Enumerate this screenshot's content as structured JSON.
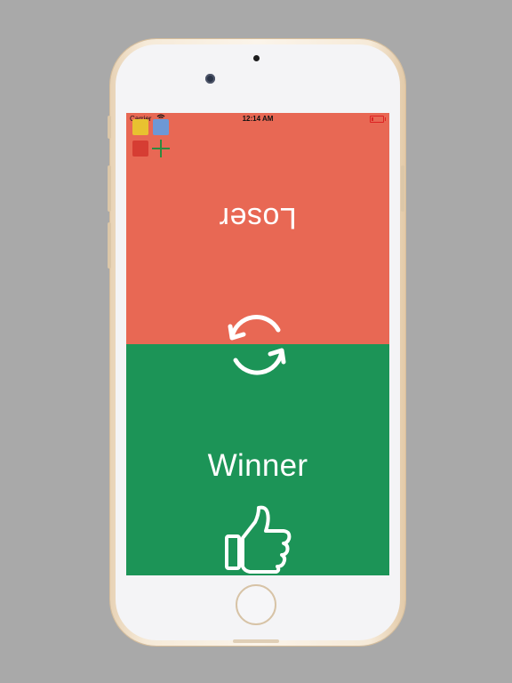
{
  "status_bar": {
    "carrier": "Carrier",
    "time": "12:14 AM",
    "battery_level": 0.15
  },
  "palette": {
    "swatches": [
      {
        "name": "yellow",
        "color": "#e8c230"
      },
      {
        "name": "blue",
        "color": "#6d98d6"
      },
      {
        "name": "red",
        "color": "#d63d33"
      }
    ],
    "add_color": "#2e8a3f"
  },
  "top_player": {
    "label": "Loser",
    "background": "#e86854"
  },
  "bottom_player": {
    "label": "Winner",
    "background": "#1c9457"
  },
  "icons": {
    "reset": "refresh-icon",
    "winner": "thumbs-up-icon"
  }
}
